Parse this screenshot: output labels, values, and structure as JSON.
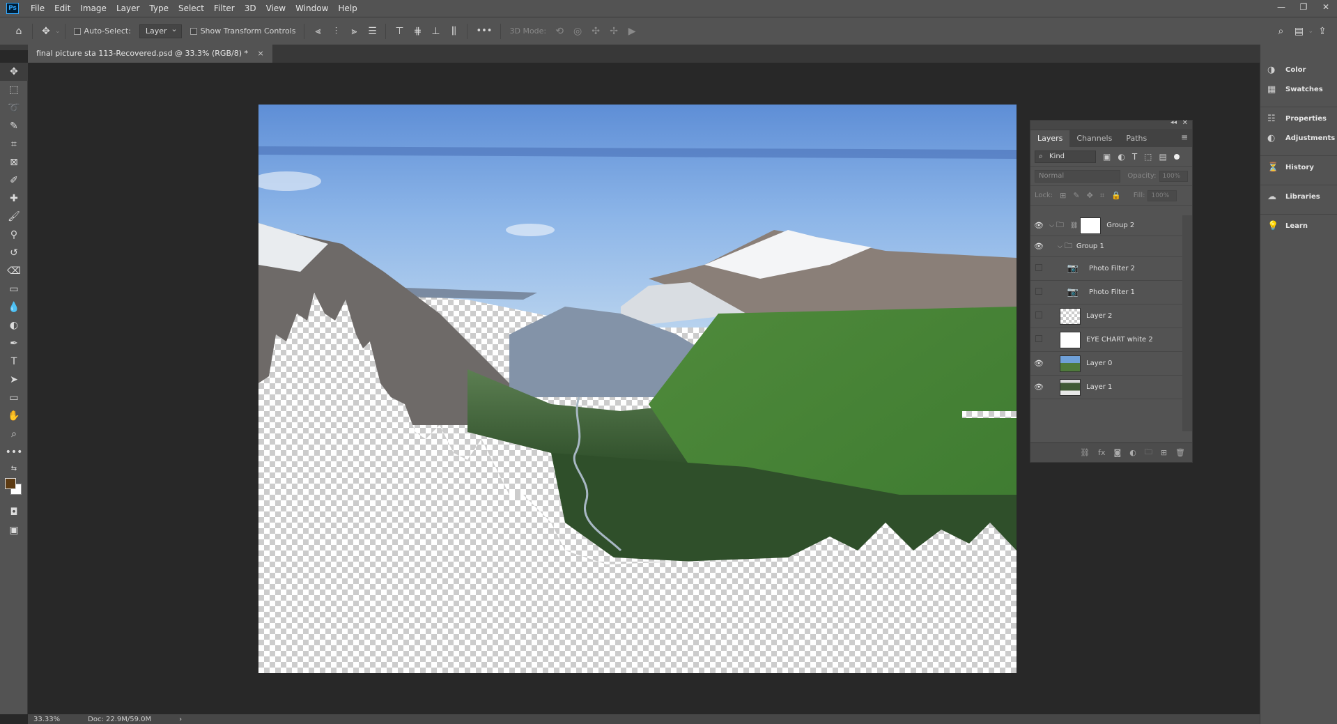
{
  "menu": {
    "logo": "Ps",
    "items": [
      "File",
      "Edit",
      "Image",
      "Layer",
      "Type",
      "Select",
      "Filter",
      "3D",
      "View",
      "Window",
      "Help"
    ]
  },
  "window_controls": [
    "—",
    "❐",
    "✕"
  ],
  "options": {
    "auto_select_label": "Auto-Select:",
    "auto_select_value": "Layer",
    "show_transform_label": "Show Transform Controls",
    "more": "•••",
    "mode_3d_label": "3D Mode:"
  },
  "document_tab": {
    "title": "final picture sta 113-Recovered.psd @ 33.3% (RGB/8) *",
    "close": "×"
  },
  "status": {
    "zoom": "33.33%",
    "doc_size": "Doc: 22.9M/59.0M",
    "arrow": "›"
  },
  "colors": {
    "foreground": "#5c3a12",
    "background": "#ffffff",
    "ui_gray": "#535353",
    "canvas_bg": "#282828"
  },
  "layers_panel": {
    "tabs": [
      "Layers",
      "Channels",
      "Paths"
    ],
    "active_tab": "Layers",
    "kind_filter": "Kind",
    "blend_mode": "Normal",
    "opacity_label": "Opacity:",
    "opacity_value": "100%",
    "lock_label": "Lock:",
    "fill_label": "Fill:",
    "fill_value": "100%",
    "layers": [
      {
        "name": "Group 2",
        "type": "group-mask",
        "visible": true
      },
      {
        "name": "Group 1",
        "type": "group",
        "visible": true
      },
      {
        "name": "Photo Filter 2",
        "type": "adjustment",
        "visible": false
      },
      {
        "name": "Photo Filter 1",
        "type": "adjustment",
        "visible": false
      },
      {
        "name": "Layer 2",
        "type": "transparent",
        "visible": false
      },
      {
        "name": "EYE CHART white 2",
        "type": "smart",
        "visible": false
      },
      {
        "name": "Layer 0",
        "type": "photo",
        "visible": true
      },
      {
        "name": "Layer 1",
        "type": "photo2",
        "visible": true
      }
    ]
  },
  "right_panels": {
    "color": "Color",
    "swatches": "Swatches",
    "properties": "Properties",
    "adjustments": "Adjustments",
    "history": "History",
    "libraries": "Libraries",
    "learn": "Learn"
  }
}
